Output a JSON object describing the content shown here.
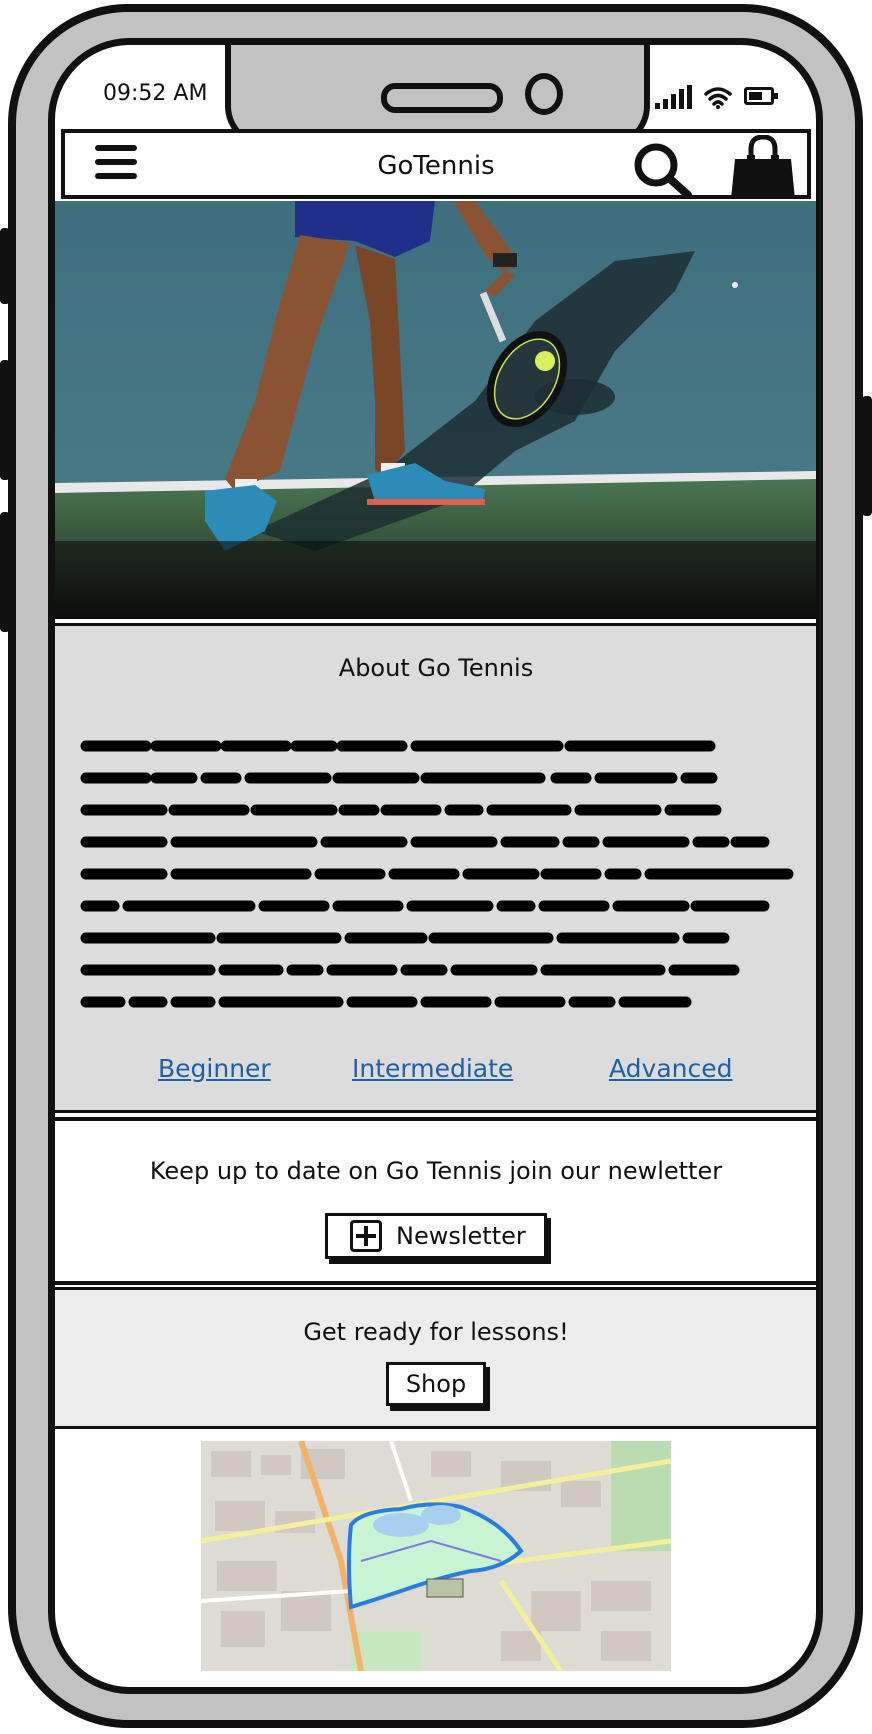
{
  "status_bar": {
    "time": "09:52 AM",
    "icons": [
      "signal-icon",
      "wifi-icon",
      "battery-icon"
    ]
  },
  "navbar": {
    "title": "GoTennis",
    "menu_icon": "hamburger-menu-icon",
    "search_icon": "search-icon",
    "cart_icon": "shopping-bag-icon"
  },
  "hero": {
    "subject": "tennis player with racket on court"
  },
  "about": {
    "title": "About Go Tennis",
    "levels": [
      "Beginner",
      "Intermediate",
      "Advanced"
    ]
  },
  "newsletter": {
    "text": "Keep up to date on Go Tennis join our newletter",
    "button_label": "Newsletter",
    "button_icon": "plus-icon"
  },
  "lessons": {
    "text": "Get ready for lessons!",
    "button_label": "Shop"
  },
  "colors": {
    "link": "#1f5fa6",
    "frame": "#c2c2c2",
    "panel": "#dcdcdc",
    "outline": "#111111"
  }
}
